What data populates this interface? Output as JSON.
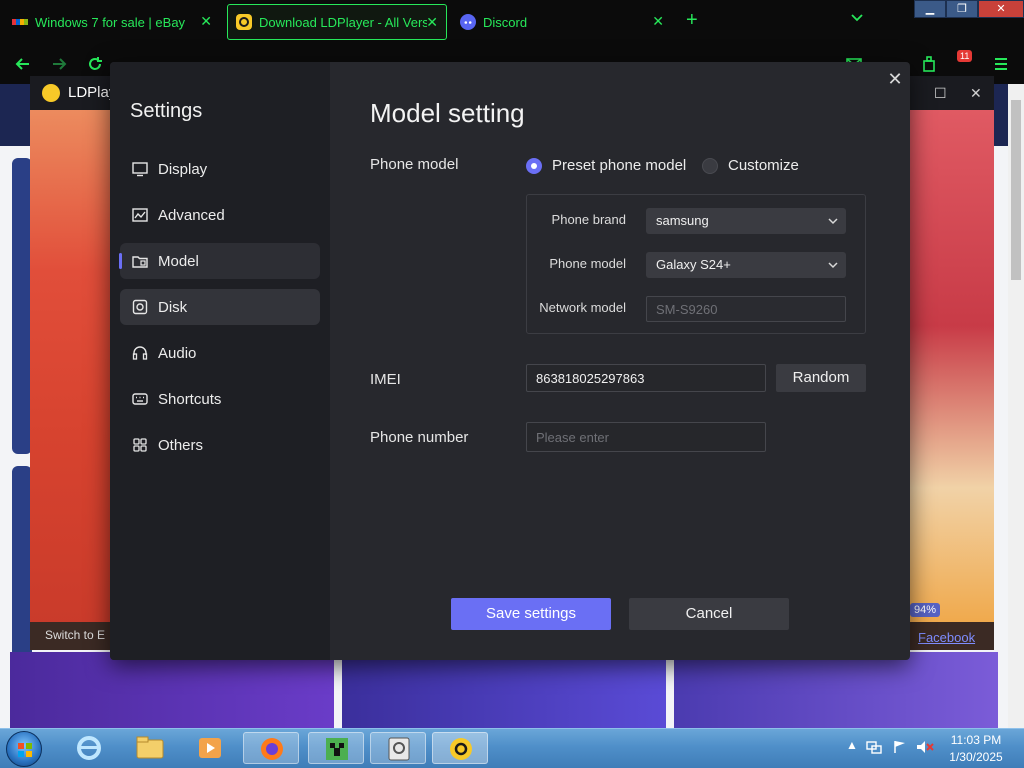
{
  "browser": {
    "tabs": [
      {
        "label": "Windows 7 for sale | eBay",
        "icon": "ebay-icon"
      },
      {
        "label": "Download LDPlayer - All Versio",
        "icon": "ldplayer-icon"
      },
      {
        "label": "Discord",
        "icon": "discord-icon"
      }
    ],
    "close_glyph": "✕",
    "new_tab_glyph": "+",
    "window_buttons": {
      "minimize": "▁",
      "maximize": "❐",
      "close": "✕"
    },
    "extension_badge": "11"
  },
  "app": {
    "title": "LDPlay",
    "footer_left": "Switch to E",
    "progress_badge": "94%",
    "facebook_link": "Facebook",
    "window_buttons": {
      "maximize": "☐",
      "close": "✕"
    }
  },
  "settings": {
    "title": "Settings",
    "close_glyph": "✕",
    "nav": [
      {
        "label": "Display",
        "icon": "monitor-icon"
      },
      {
        "label": "Advanced",
        "icon": "chart-icon"
      },
      {
        "label": "Model",
        "icon": "folder-icon",
        "selected": true
      },
      {
        "label": "Disk",
        "icon": "disk-icon"
      },
      {
        "label": "Audio",
        "icon": "audio-icon"
      },
      {
        "label": "Shortcuts",
        "icon": "keyboard-icon"
      },
      {
        "label": "Others",
        "icon": "grid-icon"
      }
    ],
    "main": {
      "title": "Model setting",
      "phone_model_label": "Phone model",
      "radio_preset": "Preset phone model",
      "radio_custom": "Customize",
      "selected_radio": "preset",
      "phone_brand_label": "Phone brand",
      "phone_brand_value": "samsung",
      "phone_model_sub_label": "Phone model",
      "phone_model_value": "Galaxy S24+",
      "network_model_label": "Network model",
      "network_model_value": "SM-S9260",
      "imei_label": "IMEI",
      "imei_value": "863818025297863",
      "random_label": "Random",
      "phone_number_label": "Phone number",
      "phone_number_placeholder": "Please enter",
      "save_label": "Save settings",
      "cancel_label": "Cancel"
    }
  },
  "taskbar": {
    "time": "11:03 PM",
    "date": "1/30/2025",
    "tray_arrow": "▲"
  },
  "colors": {
    "accent": "#6a6ff4",
    "browser_text": "#27e85a",
    "dialog_bg": "#27282d",
    "sidebar_bg": "#1e1f24"
  }
}
